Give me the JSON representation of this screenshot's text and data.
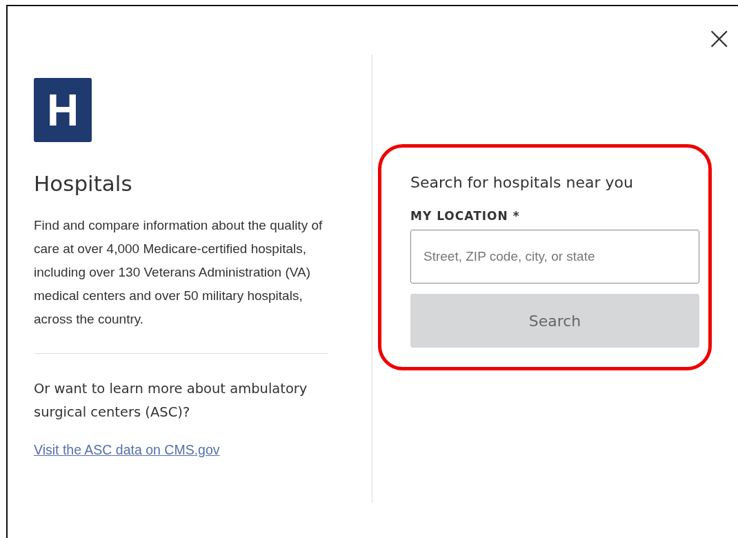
{
  "close_button": {
    "label": "×"
  },
  "info": {
    "logo_letter": "H",
    "title": "Hospitals",
    "description": "Find and compare information about the quality of care at over 4,000 Medicare-certified hospitals, including over 130 Veterans Administration (VA) medical centers and over 50 military hospitals, across the country.",
    "question": "Or want to learn more about ambulatory surgical centers (ASC)?",
    "link": "Visit the ASC data on CMS.gov"
  },
  "search": {
    "highlighted": true,
    "heading": "Search for hospitals near you",
    "label": "MY LOCATION *",
    "placeholder": "Street, ZIP code, city, or state",
    "button": {
      "label": "Search",
      "disabled": true
    }
  }
}
